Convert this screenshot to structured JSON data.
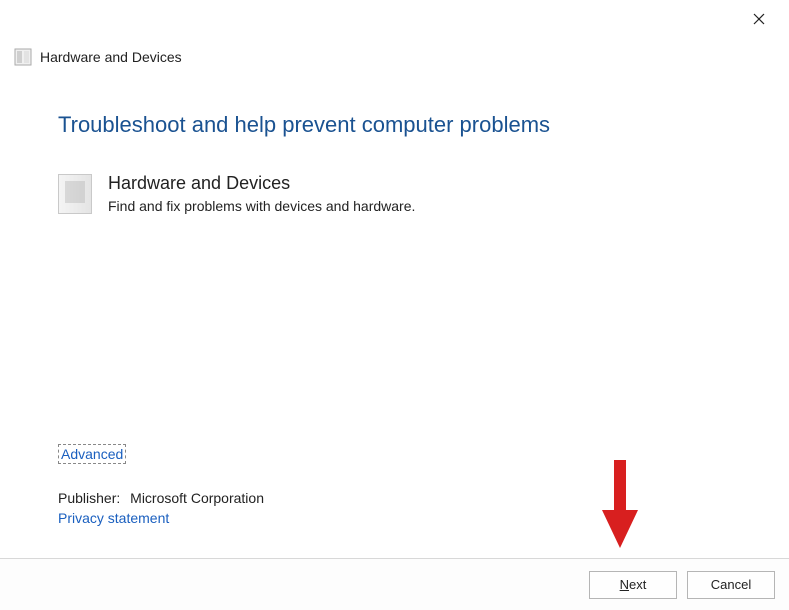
{
  "window": {
    "title": "Hardware and Devices"
  },
  "main": {
    "heading": "Troubleshoot and help prevent computer problems",
    "item": {
      "title": "Hardware and Devices",
      "description": "Find and fix problems with devices and hardware."
    }
  },
  "links": {
    "advanced": "Advanced",
    "privacy": "Privacy statement"
  },
  "publisher": {
    "label": "Publisher:",
    "name": "Microsoft Corporation"
  },
  "footer": {
    "next": "ext",
    "next_prefix": "N",
    "cancel": "Cancel"
  }
}
